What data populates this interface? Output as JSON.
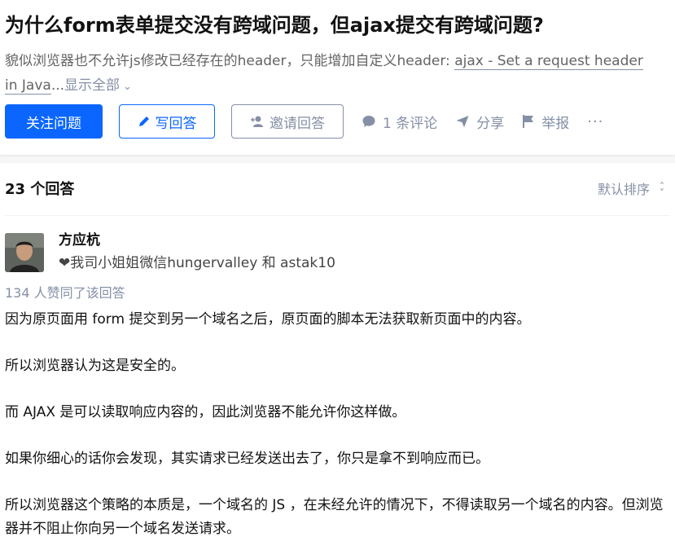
{
  "question": {
    "title": "为什么form表单提交没有跨域问题，但ajax提交有跨域问题?",
    "excerpt_text": "貌似浏览器也不允许js修改已经存在的header，只能增加自定义header: ",
    "excerpt_link": "ajax - Set a request header in Java",
    "excerpt_ellipsis": "...",
    "expand_label": "显示全部",
    "actions": {
      "follow": "关注问题",
      "write_answer": "写回答",
      "invite": "邀请回答",
      "comments": "1 条评论",
      "share": "分享",
      "report": "举报",
      "more": "···"
    }
  },
  "answers": {
    "count_label": "23 个回答",
    "sort_label": "默认排序",
    "items": [
      {
        "author_name": "方应杭",
        "author_bio": "❤我司小姐姐微信hungervalley 和 astak10",
        "upvotes": "134 人赞同了该回答",
        "paragraphs": [
          "因为原页面用 form 提交到另一个域名之后，原页面的脚本无法获取新页面中的内容。",
          "所以浏览器认为这是安全的。",
          "而 AJAX 是可以读取响应内容的，因此浏览器不能允许你这样做。",
          "如果你细心的话你会发现，其实请求已经发送出去了，你只是拿不到响应而已。",
          "所以浏览器这个策略的本质是，一个域名的 JS ，在未经允许的情况下，不得读取另一个域名的内容。但浏览器并不阻止你向另一个域名发送请求。"
        ]
      }
    ]
  },
  "colors": {
    "primary": "#0a66ff",
    "meta": "#8590a6",
    "text": "#121212"
  }
}
